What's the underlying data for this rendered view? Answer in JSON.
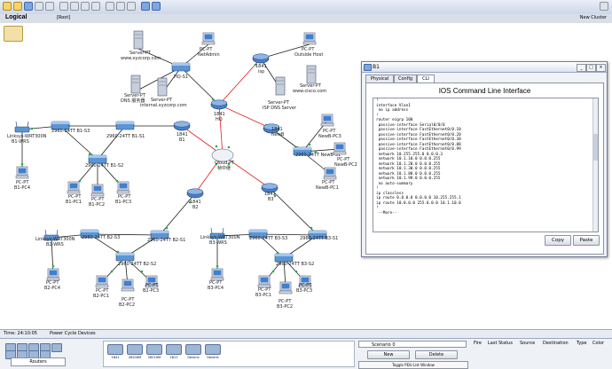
{
  "logical_bar": {
    "title": "Logical",
    "root": "[Root]",
    "new_cluster": "New Cluster"
  },
  "status_bar": {
    "time": "Time: 24:10:05",
    "power": "Power Cycle Devices"
  },
  "device_panel": {
    "category_label": "Routers",
    "devices": [
      "1841",
      "2620XM",
      "2621XM",
      "2811",
      "Generic",
      "Generic"
    ]
  },
  "scenario": {
    "select": "Scenario 0",
    "new_label": "New",
    "delete_label": "Delete",
    "toggle_label": "Toggle PDU List Window"
  },
  "pdu_headers": [
    "Fire",
    "Last Status",
    "Source",
    "Destination",
    "Type",
    "Color"
  ],
  "window": {
    "title": "B1",
    "tabs": [
      "Physical",
      "Config",
      "CLI"
    ],
    "active_tab": "CLI",
    "cli_title": "IOS Command Line Interface",
    "console_lines": [
      "!",
      "interface Vlan1",
      " no ip address",
      "!",
      "router eigrp 100",
      " passive-interface Serial0/0/0",
      " passive-interface FastEthernet0/0.10",
      " passive-interface FastEthernet0/0.20",
      " passive-interface FastEthernet0/0.30",
      " passive-interface FastEthernet0/0.88",
      " passive-interface FastEthernet0/0.99",
      " network 10.255.255.0 0.0.0.3",
      " network 10.1.10.0 0.0.0.255",
      " network 10.1.20.0 0.0.0.255",
      " network 10.1.30.0 0.0.0.255",
      " network 10.1.88.0 0.0.0.255",
      " network 10.1.99.0 0.0.0.255",
      " no auto-summary",
      "!",
      "ip classless",
      "ip route 0.0.0.0 0.0.0.0 10.255.255.1",
      "ip route 10.0.0.0 255.0.0.0 10.1.10.0",
      "!",
      " --More--"
    ],
    "copy_label": "Copy",
    "paste_label": "Paste"
  },
  "topology_labels": {
    "server_www": [
      "Server-PT",
      "www.xyzcorp.com"
    ],
    "netadmin": [
      "PC-PT",
      "NetAdmin"
    ],
    "hq_s1": "HQ-S1",
    "dns_server": [
      "Server-PT",
      "DNS 服务器"
    ],
    "internal_server": [
      "Server-PT",
      "internal.xyzcorp.com"
    ],
    "isp": [
      "1841",
      "isp"
    ],
    "outside_host": [
      "PC-PT",
      "Outside Host"
    ],
    "cisco_server": [
      "Server-PT",
      "www.cisco.com"
    ],
    "isp_dns": [
      "Server-PT",
      "ISP DNS Server"
    ],
    "hq": [
      "1841",
      "HQ"
    ],
    "newb": [
      "1841",
      "NewB"
    ],
    "newb_s1": "2960-24TT NewB-S1",
    "newb_pc3": [
      "PC-PT",
      "NewB-PC3"
    ],
    "newb_pc2": [
      "PC-PT",
      "NewB-PC2"
    ],
    "newb_pc1": [
      "PC-PT",
      "NewB-PC1"
    ],
    "cloud": [
      "Cloud-PT",
      "帧中继"
    ],
    "b1": [
      "1841",
      "B1"
    ],
    "b1_s3": "2960-24TT B1-S3",
    "b1_s1": "2960-24TT B1-S1",
    "b1_s2": "2960-24TT B1-S2",
    "b1_wrs": [
      "Linksys-WRT300N",
      "B1-WRS"
    ],
    "b1_pc4": [
      "PC-PT",
      "B1-PC4"
    ],
    "b1_pc1": [
      "PC-PT",
      "B1-PC1"
    ],
    "b1_pc2": [
      "PC-PT",
      "B1-PC2"
    ],
    "b1_pc3": [
      "PC-PT",
      "B1-PC3"
    ],
    "b2": [
      "1841",
      "B2"
    ],
    "b2_s3": "2960-24TT B2-S3",
    "b2_s1": "2960-24TT B2-S1",
    "b2_s2": "2960-24TT B2-S2",
    "b2_wrs": [
      "Linksys-WRT300N",
      "B2-WRS"
    ],
    "b2_pc4": [
      "PC-PT",
      "B2-PC4"
    ],
    "b2_pc1": [
      "PC-PT",
      "B2-PC1"
    ],
    "b2_pc2": [
      "PC-PT",
      "B2-PC2"
    ],
    "b2_pc3": [
      "PC-PT",
      "B2-PC3"
    ],
    "b3": [
      "1841",
      "B3"
    ],
    "b3_s3": "2960-24TT B3-S3",
    "b3_s1": "2960-24TT B3-S1",
    "b3_s2": "2960-24TT B3-S2",
    "b3_wrs": [
      "Linksys-WRT300N",
      "B3-WRS"
    ],
    "b3_pc4": [
      "PC-PT",
      "B3-PC4"
    ],
    "b3_pc1": [
      "PC-PT",
      "B3-PC1"
    ],
    "b3_pc2": [
      "PC-PT",
      "B3-PC2"
    ],
    "b3_pc3": [
      "PC-PT",
      "B3-PC3"
    ]
  },
  "colors": {
    "link": "#1f1f1f",
    "serial": "#e02020",
    "port_up": "#22b14c",
    "router": "#3a6fb5",
    "switch": "#4a86c8"
  }
}
